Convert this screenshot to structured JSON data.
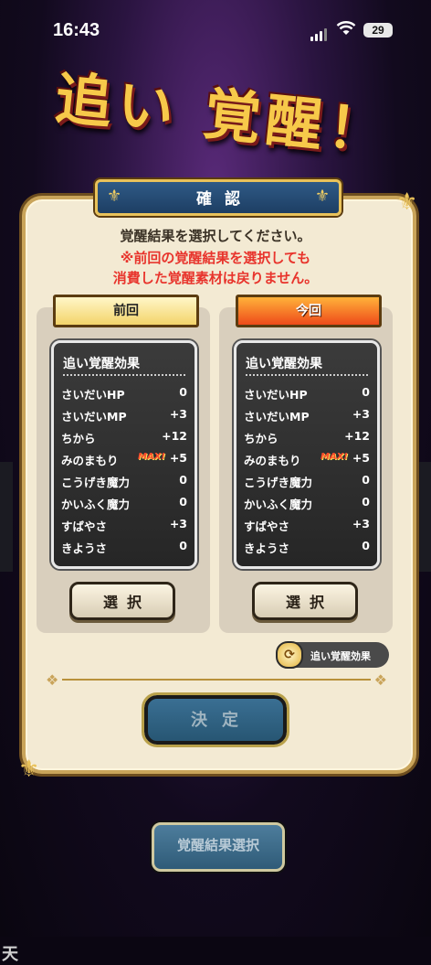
{
  "status": {
    "time": "16:43",
    "battery": "29"
  },
  "banner": {
    "text": "追い 覚醒！"
  },
  "background": {
    "side_glyph": "天"
  },
  "dialog": {
    "header": "確認",
    "message_line1": "覚醒結果を選択してください。",
    "message_line2": "※前回の覚醒結果を選択しても",
    "message_line3": "消費した覚醒素材は戻りません。",
    "colors": {
      "warning": "#e8342c",
      "header_bg": "#2f5a86",
      "frame_gold": "#c9a45a"
    }
  },
  "previous": {
    "ribbon": "前回",
    "box_title": "追い覚醒効果",
    "stats": [
      {
        "name": "さいだいHP",
        "value": "0",
        "max": ""
      },
      {
        "name": "さいだいMP",
        "value": "+3",
        "max": ""
      },
      {
        "name": "ちから",
        "value": "+12",
        "max": ""
      },
      {
        "name": "みのまもり",
        "value": "+5",
        "max": "MAX!"
      },
      {
        "name": "こうげき魔力",
        "value": "0",
        "max": ""
      },
      {
        "name": "かいふく魔力",
        "value": "0",
        "max": ""
      },
      {
        "name": "すばやさ",
        "value": "+3",
        "max": ""
      },
      {
        "name": "きようさ",
        "value": "0",
        "max": ""
      }
    ],
    "select_label": "選択"
  },
  "current": {
    "ribbon": "今回",
    "box_title": "追い覚醒効果",
    "stats": [
      {
        "name": "さいだいHP",
        "value": "0",
        "max": ""
      },
      {
        "name": "さいだいMP",
        "value": "+3",
        "max": ""
      },
      {
        "name": "ちから",
        "value": "+12",
        "max": ""
      },
      {
        "name": "みのまもり",
        "value": "+5",
        "max": "MAX!"
      },
      {
        "name": "こうげき魔力",
        "value": "0",
        "max": ""
      },
      {
        "name": "かいふく魔力",
        "value": "0",
        "max": ""
      },
      {
        "name": "すばやさ",
        "value": "+3",
        "max": ""
      },
      {
        "name": "きようさ",
        "value": "0",
        "max": ""
      }
    ],
    "select_label": "選択"
  },
  "toggle": {
    "label": "追い覚醒効果"
  },
  "decide_label": "決定",
  "bottom_button": "覚醒結果選択"
}
